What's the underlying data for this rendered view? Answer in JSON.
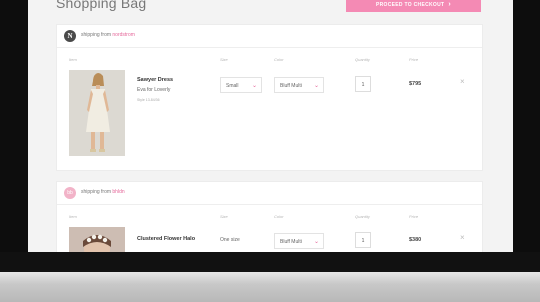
{
  "page": {
    "title": "Shopping Bag",
    "checkout_label": "PROCEED TO CHECKOUT",
    "accent_color": "#f48ab4"
  },
  "columns": {
    "item": "Item",
    "size": "Size",
    "color": "Color",
    "quantity": "Quantity",
    "price": "Price"
  },
  "orders": [
    {
      "ship_prefix": "shipping from",
      "store": "nordstrom",
      "logo_text": "N",
      "product": {
        "name": "Sawyer Dress",
        "brand": "Eva for Loverly",
        "style": "Style 13-84/36",
        "size": "Small",
        "color": "Bluff Multi",
        "quantity": "1",
        "price": "$795"
      }
    },
    {
      "ship_prefix": "shipping from",
      "store": "bhldn",
      "logo_text": "bb",
      "product": {
        "name": "Clustered Flower Halo",
        "brand": "",
        "style": "",
        "size": "One size",
        "color": "Bluff Multi",
        "quantity": "1",
        "price": "$380"
      }
    }
  ],
  "icons": {
    "remove": "×",
    "caret": "⌄",
    "chevron": "›"
  }
}
